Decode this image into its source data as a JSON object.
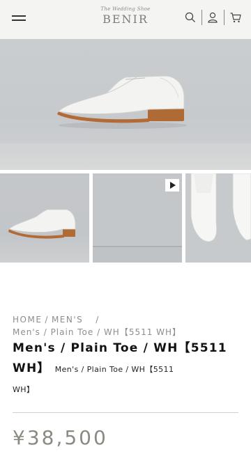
{
  "header": {
    "logo_script": "The Wedding Shoe",
    "logo_main": "BENIR",
    "icons": [
      "menu-icon",
      "search-icon",
      "account-icon",
      "cart-icon"
    ]
  },
  "gallery": {
    "thumbnails": [
      {
        "kind": "image"
      },
      {
        "kind": "video",
        "badge_icon": "play-icon"
      },
      {
        "kind": "image"
      }
    ]
  },
  "breadcrumb": {
    "items": [
      "HOME",
      "MEN'S",
      "Men's / Plain Toe / WH【5511 WH】"
    ]
  },
  "product": {
    "title": "Men's / Plain Toe / WH【5511 WH】",
    "subtitle_inline": "Men's / Plain Toe / WH【5511",
    "subtitle_wrap": "WH】",
    "price": "¥38,500"
  },
  "colors": {
    "accent_price": "#8a8a80",
    "header_bg": "#f4f4f2"
  }
}
